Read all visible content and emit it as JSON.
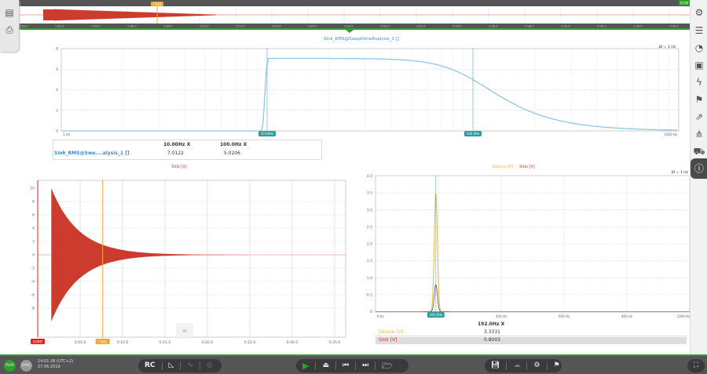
{
  "timeline": {
    "ticks": [
      "0:00.0",
      "0:02.0",
      "0:04.0",
      "0:06.0",
      "0:08.0",
      "0:10.0",
      "0:12.0",
      "0:14.0",
      "0:16.0",
      "0:18.0",
      "0:20.0",
      "0:22.0",
      "0:24.0",
      "0:26.0",
      "0:28.0",
      "0:30.0",
      "0:32.0",
      "0:34.0",
      "0:36.0"
    ],
    "cursor_label": "7.661",
    "stop_label": "STOP"
  },
  "left_toolbar": [
    "layers-icon",
    "printer-icon"
  ],
  "right_toolbar": [
    "gear-icon",
    "list-icon",
    "gauge-icon",
    "report-icon",
    "lightning-icon",
    "flag-icon",
    "export-icon",
    "hierarchy-icon",
    "car-icon",
    "info-icon"
  ],
  "chart_data": [
    {
      "type": "line",
      "title": "Sink_RMS@SweptSineAnalysis_1 []",
      "xscale": "log",
      "xlim": [
        1,
        1000
      ],
      "ylim": [
        0,
        8
      ],
      "x_tick_labels": [
        "1 Hz",
        "1000 Hz"
      ],
      "y_ticks": [
        "0",
        "2",
        "4",
        "6",
        "8"
      ],
      "resolution": "Δf = 1 Hz",
      "series": [
        {
          "name": "Sink_RMS",
          "x": [
            1,
            9.5,
            10,
            20,
            50,
            100,
            150,
            200,
            300,
            500,
            1000
          ],
          "y": [
            0,
            0,
            7.0,
            7.0,
            6.5,
            5.02,
            3.4,
            2.3,
            1.1,
            0.2,
            0.05
          ],
          "color": "#8ec6e6"
        }
      ],
      "cursors": [
        {
          "label": "10.00Hz",
          "x": 10
        },
        {
          "label": "100.0Hz",
          "x": 100
        }
      ],
      "table": {
        "headers": [
          "10.00Hz X",
          "100.0Hz X"
        ],
        "row_label": "Sink_RMS@Swe....alysis_1 []",
        "values": [
          "7.0122",
          "5.0206"
        ]
      }
    },
    {
      "type": "area",
      "title": "Sink [V]",
      "xlim": [
        0,
        37
      ],
      "ylim": [
        -10,
        10
      ],
      "x_tick_labels": [
        "0:05.0",
        "0:10.0",
        "0:15.0",
        "0:20.0",
        "0:25.0",
        "0:30.0",
        "0:35.0"
      ],
      "y_ticks": [
        "10",
        "8",
        "6",
        "4",
        "2",
        "0",
        "-2",
        "-4",
        "-6",
        "-8"
      ],
      "series": [
        {
          "name": "Sink",
          "envelope_start_s": 1.6,
          "peak": 10,
          "decay_s": 3.2,
          "color": "#cc3b2e"
        }
      ],
      "markers": [
        {
          "label": "START",
          "x": 0,
          "color": "#e02020"
        },
        {
          "label": "7.661",
          "x": 7.661,
          "color": "#f0a830"
        }
      ],
      "scroll_label": "»"
    },
    {
      "type": "line",
      "title_source": "Source [V]",
      "title_sink": "Sink [V]",
      "xlim": [
        0,
        1000
      ],
      "ylim": [
        0,
        4
      ],
      "x_tick_labels": [
        "0 Hz",
        "400 Hz",
        "600 Hz",
        "800 Hz",
        "1000 Hz"
      ],
      "y_ticks": [
        "4.0",
        "3.5",
        "3.0",
        "2.5",
        "2.0",
        "1.5",
        "1.0",
        "0.5",
        "0"
      ],
      "resolution": "Δf = 1 Hz",
      "series": [
        {
          "name": "Source [V]",
          "peak_x": 192,
          "peak_y": 3.5,
          "color": "#f5b63a"
        },
        {
          "name": "Sink [V]",
          "peak_x": 192,
          "peak_y": 0.8,
          "color": "#cc3b2e"
        }
      ],
      "cursor": {
        "label": "192.0Hz",
        "x": 192
      },
      "table": {
        "header": "192.0Hz X",
        "rows": [
          {
            "label": "Source [V]",
            "value": "3.3331",
            "color": "#f5b63a"
          },
          {
            "label": "Sink [V]",
            "value": "0.8003",
            "color": "#cc3b2e"
          }
        ]
      }
    }
  ],
  "bottom_bar": {
    "play_label": "PLAY",
    "sync_label": "SYNC",
    "time": "14:01:28 (UTC+2)",
    "date": "27.06.2019",
    "rc_label": "RC"
  },
  "colors": {
    "accent_green": "#2ea02e",
    "teal": "#2a9c9c",
    "dark": "#555555"
  }
}
